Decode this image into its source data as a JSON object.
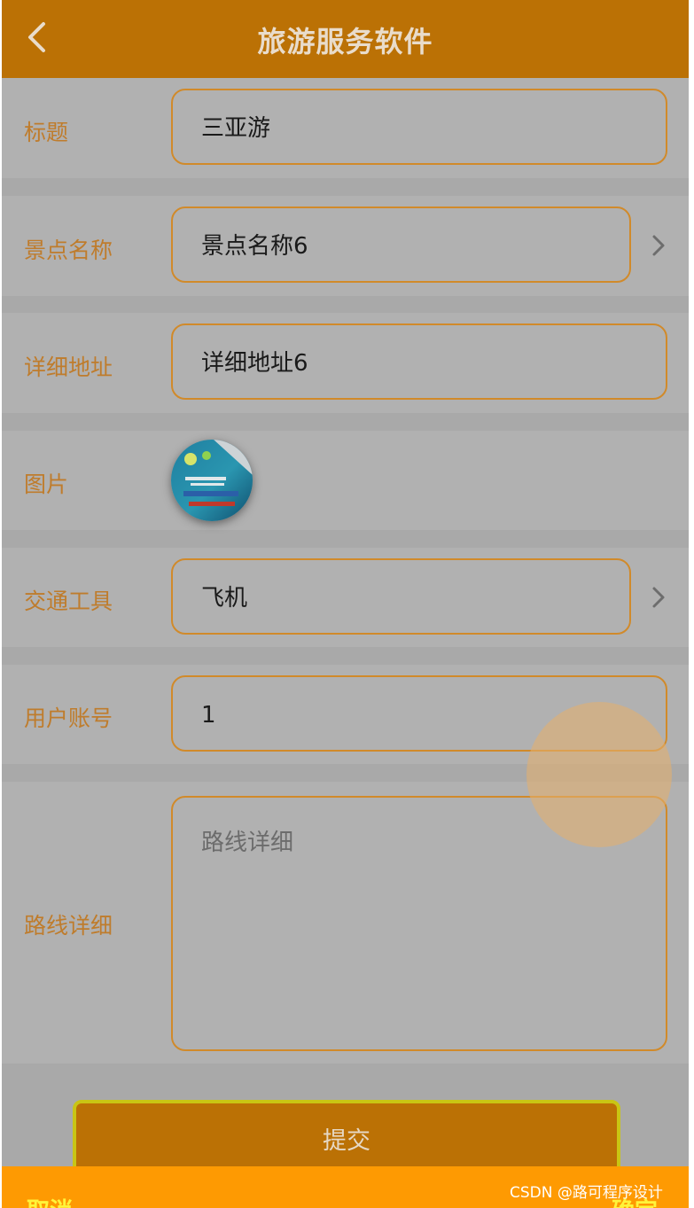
{
  "header": {
    "title": "旅游服务软件",
    "back_icon": "chevron-left-icon"
  },
  "form": {
    "title": {
      "label": "标题",
      "value": "三亚游"
    },
    "scenic_name": {
      "label": "景点名称",
      "value": "景点名称6",
      "icon": "chevron-right-icon"
    },
    "address": {
      "label": "详细地址",
      "value": "详细地址6"
    },
    "picture": {
      "label": "图片"
    },
    "transport": {
      "label": "交通工具",
      "value": "飞机",
      "icon": "chevron-right-icon"
    },
    "account": {
      "label": "用户账号",
      "value": "1"
    },
    "route": {
      "label": "路线详细",
      "placeholder": "路线详细"
    }
  },
  "submit_label": "提交",
  "bottom_bar": {
    "cancel_label": "取消",
    "confirm_label": "确定"
  },
  "watermark": "CSDN @路可程序设计",
  "colors": {
    "header_bg": "#bb7105",
    "label": "#bf7c2c",
    "field_border": "#d18a2a",
    "bottom_bar_bg": "#fe9a02",
    "bottom_bar_text": "#fff43a",
    "submit_border": "#c9c514"
  }
}
